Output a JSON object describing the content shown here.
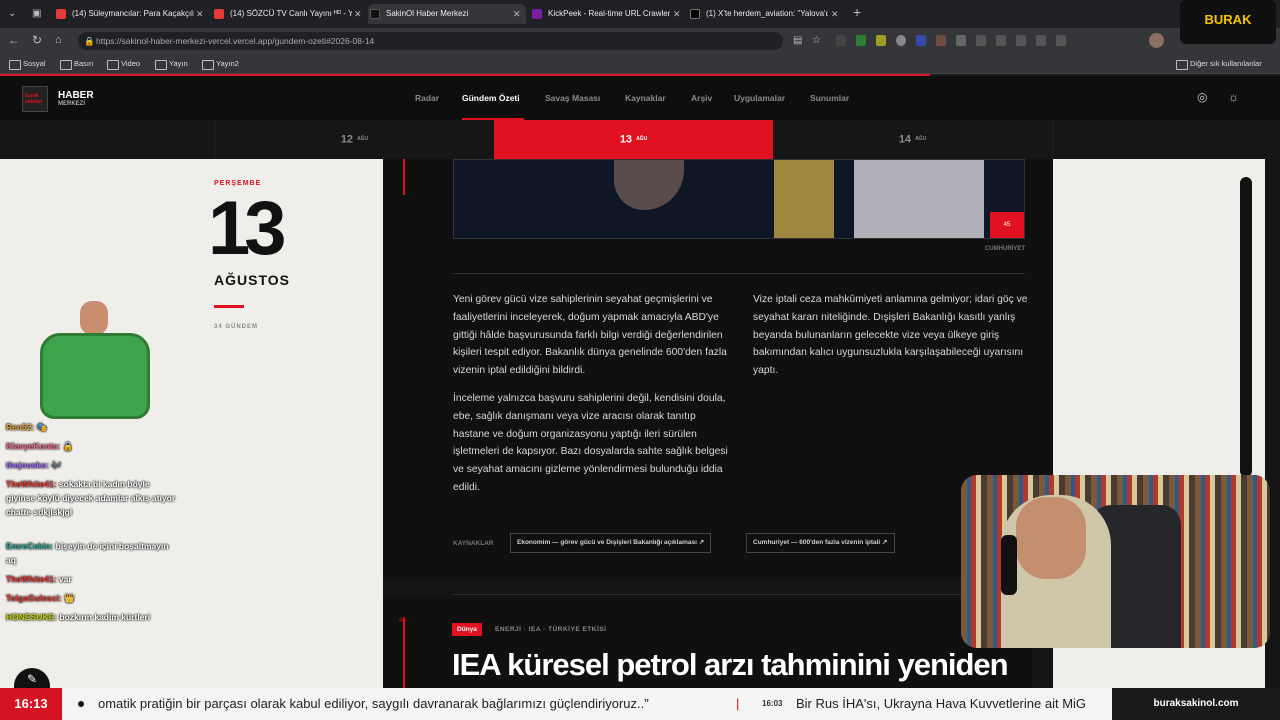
{
  "browser": {
    "tabs": [
      {
        "label": "(14) Süleymancılar: Para Kaçakçılığ",
        "color": "#e53935"
      },
      {
        "label": "(14) SÖZCÜ TV Canlı Yayını ᴴᴰ - Yo",
        "color": "#e53935"
      },
      {
        "label": "SakinOl Haber Merkezi",
        "color": "#111111"
      },
      {
        "label": "KickPeek - Real-time URL Crawler",
        "color": "#7b1fa2"
      },
      {
        "label": "(1) X'te herdem_aviation: \"Yalova'd",
        "color": "#000000"
      }
    ],
    "url": "https://sakinol-haber-merkezi-vercel.vercel.app/gundem-ozeti#2026-08-14",
    "bookmarks": [
      "Sosyal",
      "Basın",
      "Video",
      "Yayın",
      "Yayın2"
    ],
    "other_bookmarks": "Diğer sık kullanılanlar"
  },
  "site": {
    "logo_line1": "HABER",
    "logo_line2": "MERKEZİ",
    "logo_mark": "burak sakinol",
    "nav": [
      "Radar",
      "Gündem Özeti",
      "Savaş Masası",
      "Kaynaklar",
      "Arşiv",
      "Uygulamalar",
      "Sunumlar"
    ],
    "active_nav": "Gündem Özeti",
    "dates": [
      {
        "day": "12",
        "mon": "AĞU"
      },
      {
        "day": "13",
        "mon": "AĞU"
      },
      {
        "day": "14",
        "mon": "AĞU"
      }
    ]
  },
  "day_panel": {
    "weekday": "PERŞEMBE",
    "day": "13",
    "month": "AĞUSTOS",
    "count": "34 GÜNDEM"
  },
  "article": {
    "image_badge": "45",
    "image_credit": "CUMHURİYET",
    "col1_p1": "Yeni görev gücü vize sahiplerinin seyahat geçmişlerini ve faaliyetlerini inceleyerek, doğum yapmak amacıyla ABD'ye gittiği hâlde başvurusunda farklı bilgi verdiği değerlendirilen kişileri tespit ediyor. Bakanlık dünya genelinde 600'den fazla vizenin iptal edildiğini bildirdi.",
    "col1_p2": "İnceleme yalnızca başvuru sahiplerini değil, kendisini doula, ebe, sağlık danışmanı veya vize aracısı olarak tanıtıp hastane ve doğum organizasyonu yaptığı ileri sürülen işletmeleri de kapsıyor. Bazı dosyalarda sahte sağlık belgesi ve seyahat amacını gizleme yönlendirmesi bulunduğu iddia edildi.",
    "col2_p1": "Vize iptali ceza mahkûmiyeti anlamına gelmiyor; idari göç ve seyahat kararı niteliğinde. Dışişleri Bakanlığı kasıtlı yanlış beyanda bulunanların gelecekte vize veya ülkeye giriş bakımından kalıcı uygunsuzlukla karşılaşabileceği uyarısını yaptı.",
    "sources_label": "KAYNAKLAR",
    "sources": [
      "Ekonomim — görev gücü ve Dışişleri Bakanlığı açıklaması ↗",
      "Cumhuriyet — 600'den fazla vizenin iptali ↗"
    ]
  },
  "next_article": {
    "number": "45",
    "tag": "Dünya",
    "kicker": "ENERJİ · IEA · TÜRKİYE ETKİSİ",
    "headline": "IEA küresel petrol arzı tahminini yeniden"
  },
  "stream": {
    "overlay_name": "BURAK",
    "chat": [
      {
        "user": "Ren52:",
        "msg": "🎭",
        "ucolor": "#e0a23c"
      },
      {
        "user": "KlavyeKonta:",
        "msg": "🔒",
        "ucolor": "#f06292"
      },
      {
        "user": "thejousko:",
        "msg": "🎶",
        "ucolor": "#9c6bff"
      },
      {
        "user": "TheWhite41:",
        "msg": "sokakta bi kadın böyle giyinse köylü diyecek adamlar alkış atıyor chatte sdkjlskjgl",
        "ucolor": "#e53935"
      },
      {
        "user": "EmreCekin:",
        "msg": "bişeyin de içini boşaltmayın aq",
        "ucolor": "#26a69a"
      },
      {
        "user": "TheWhite41:",
        "msg": "var",
        "ucolor": "#e53935"
      },
      {
        "user": "TolgaGulesci:",
        "msg": "👑",
        "ucolor": "#e53935"
      },
      {
        "user": "HONESUKE:",
        "msg": "bozkırın kadim kürtleri",
        "ucolor": "#c6d200"
      }
    ]
  },
  "ticker": {
    "time": "16:13",
    "text1": "omatik pratiğin bir parçası olarak kabul ediliyor, saygılı davranarak bağlarımızı güçlendiriyoruz..\"",
    "time2": "16:03",
    "text2": "Bir Rus İHA'sı, Ukrayna Hava Kuvvetlerine ait MiG",
    "brand": "buraksakinol.com"
  },
  "colors": {
    "accent": "#e0121f",
    "panel": "#efeeea"
  }
}
